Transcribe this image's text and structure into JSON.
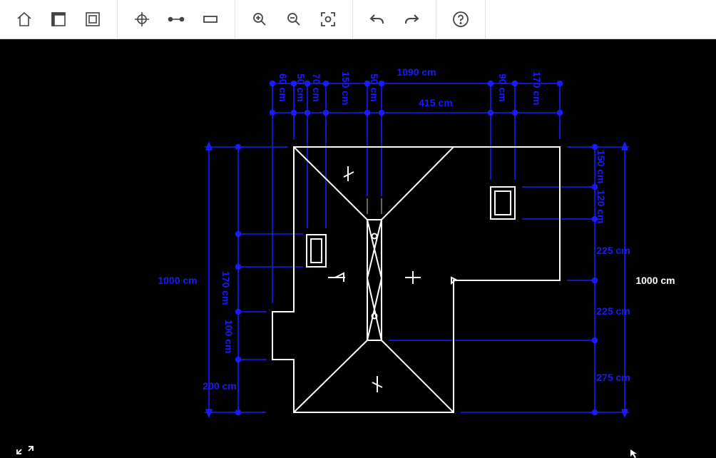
{
  "toolbar": {
    "groups": [
      {
        "name": "view",
        "buttons": [
          {
            "name": "home-icon"
          },
          {
            "name": "wall-icon"
          },
          {
            "name": "room-icon"
          }
        ]
      },
      {
        "name": "draw",
        "buttons": [
          {
            "name": "crosshair-icon"
          },
          {
            "name": "line-tool-icon"
          },
          {
            "name": "rectangle-tool-icon"
          }
        ]
      },
      {
        "name": "zoom",
        "buttons": [
          {
            "name": "zoom-in-icon"
          },
          {
            "name": "zoom-out-icon"
          },
          {
            "name": "zoom-fit-icon"
          }
        ]
      },
      {
        "name": "history",
        "buttons": [
          {
            "name": "undo-icon"
          },
          {
            "name": "redo-icon"
          }
        ]
      },
      {
        "name": "help",
        "buttons": [
          {
            "name": "help-icon"
          }
        ]
      }
    ]
  },
  "plan": {
    "colors": {
      "dimension": "#1a1aff",
      "outline": "#ffffff",
      "background": "#000000"
    },
    "top_dimensions": {
      "overall": "1090 cm",
      "segment": "415 cm",
      "vertical_labels": [
        "60 cm",
        "50 cm",
        "70 cm",
        "150 cm",
        "50 cm",
        "90 cm",
        "170 cm"
      ]
    },
    "left_dimensions": {
      "overall": "1000 cm",
      "segments": [
        "170 cm",
        "100 cm",
        "200 cm"
      ]
    },
    "right_dimensions": {
      "overall": "1000 cm",
      "segments": [
        "150 cm",
        "120 cm",
        "225 cm",
        "225 cm",
        "275 cm"
      ]
    }
  }
}
